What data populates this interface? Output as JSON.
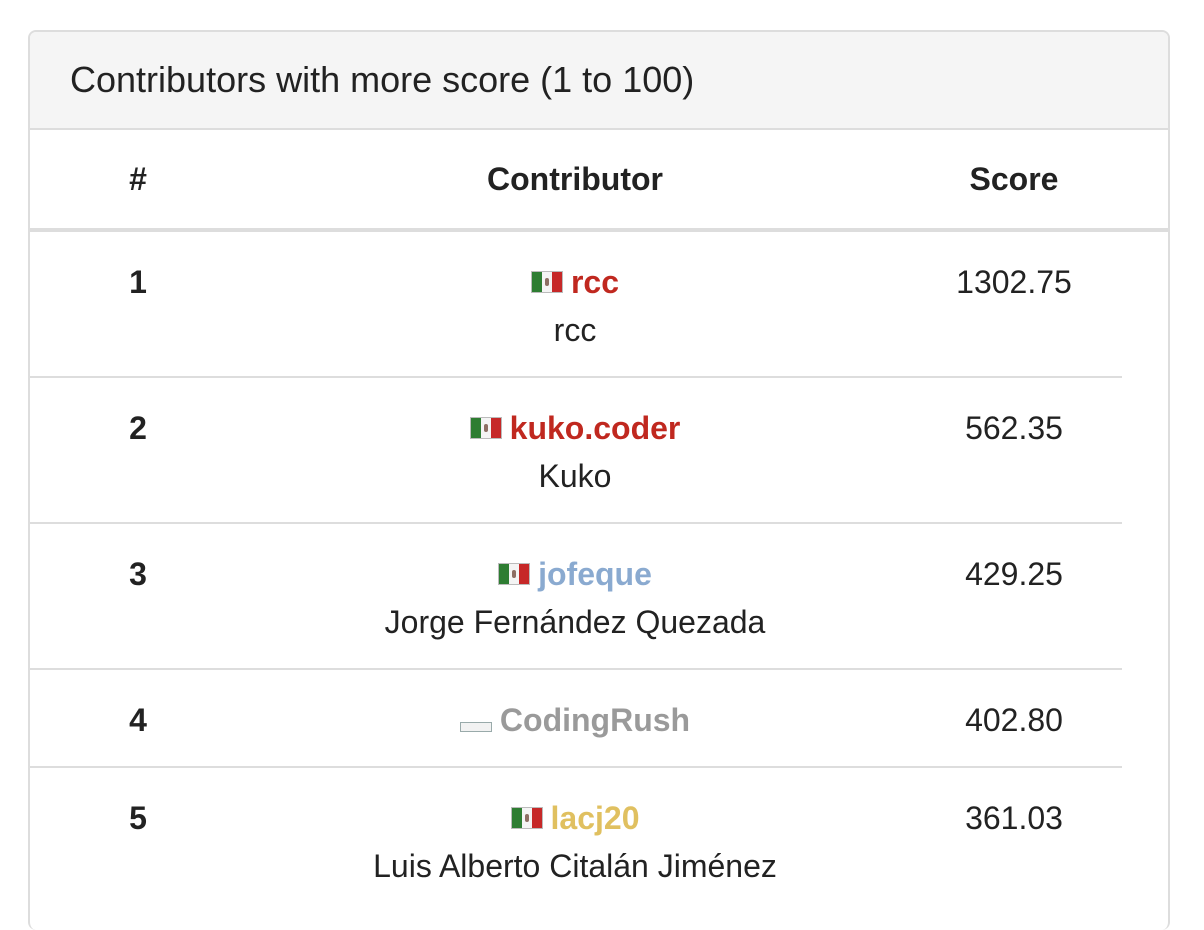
{
  "panel": {
    "title": "Contributors with more score (1 to 100)"
  },
  "table": {
    "headers": {
      "rank": "#",
      "contributor": "Contributor",
      "score": "Score"
    },
    "rows": [
      {
        "rank": "1",
        "handle": "rcc",
        "name": "rcc",
        "score": "1302.75",
        "handle_color": "#c0281f",
        "flag": "flag-mexico-icon"
      },
      {
        "rank": "2",
        "handle": "kuko.coder",
        "name": "Kuko",
        "score": "562.35",
        "handle_color": "#c0281f",
        "flag": "flag-mexico-icon"
      },
      {
        "rank": "3",
        "handle": "jofeque",
        "name": "Jorge Fernández Quezada",
        "score": "429.25",
        "handle_color": "#8aaad0",
        "flag": "flag-mexico-icon"
      },
      {
        "rank": "4",
        "handle": "CodingRush",
        "name": "",
        "score": "402.80",
        "handle_color": "#9a9a9a",
        "flag": "flag-unknown-icon"
      },
      {
        "rank": "5",
        "handle": "lacj20",
        "name": "Luis Alberto Citalán Jiménez",
        "score": "361.03",
        "handle_color": "#e0c060",
        "flag": "flag-mexico-icon"
      }
    ]
  }
}
